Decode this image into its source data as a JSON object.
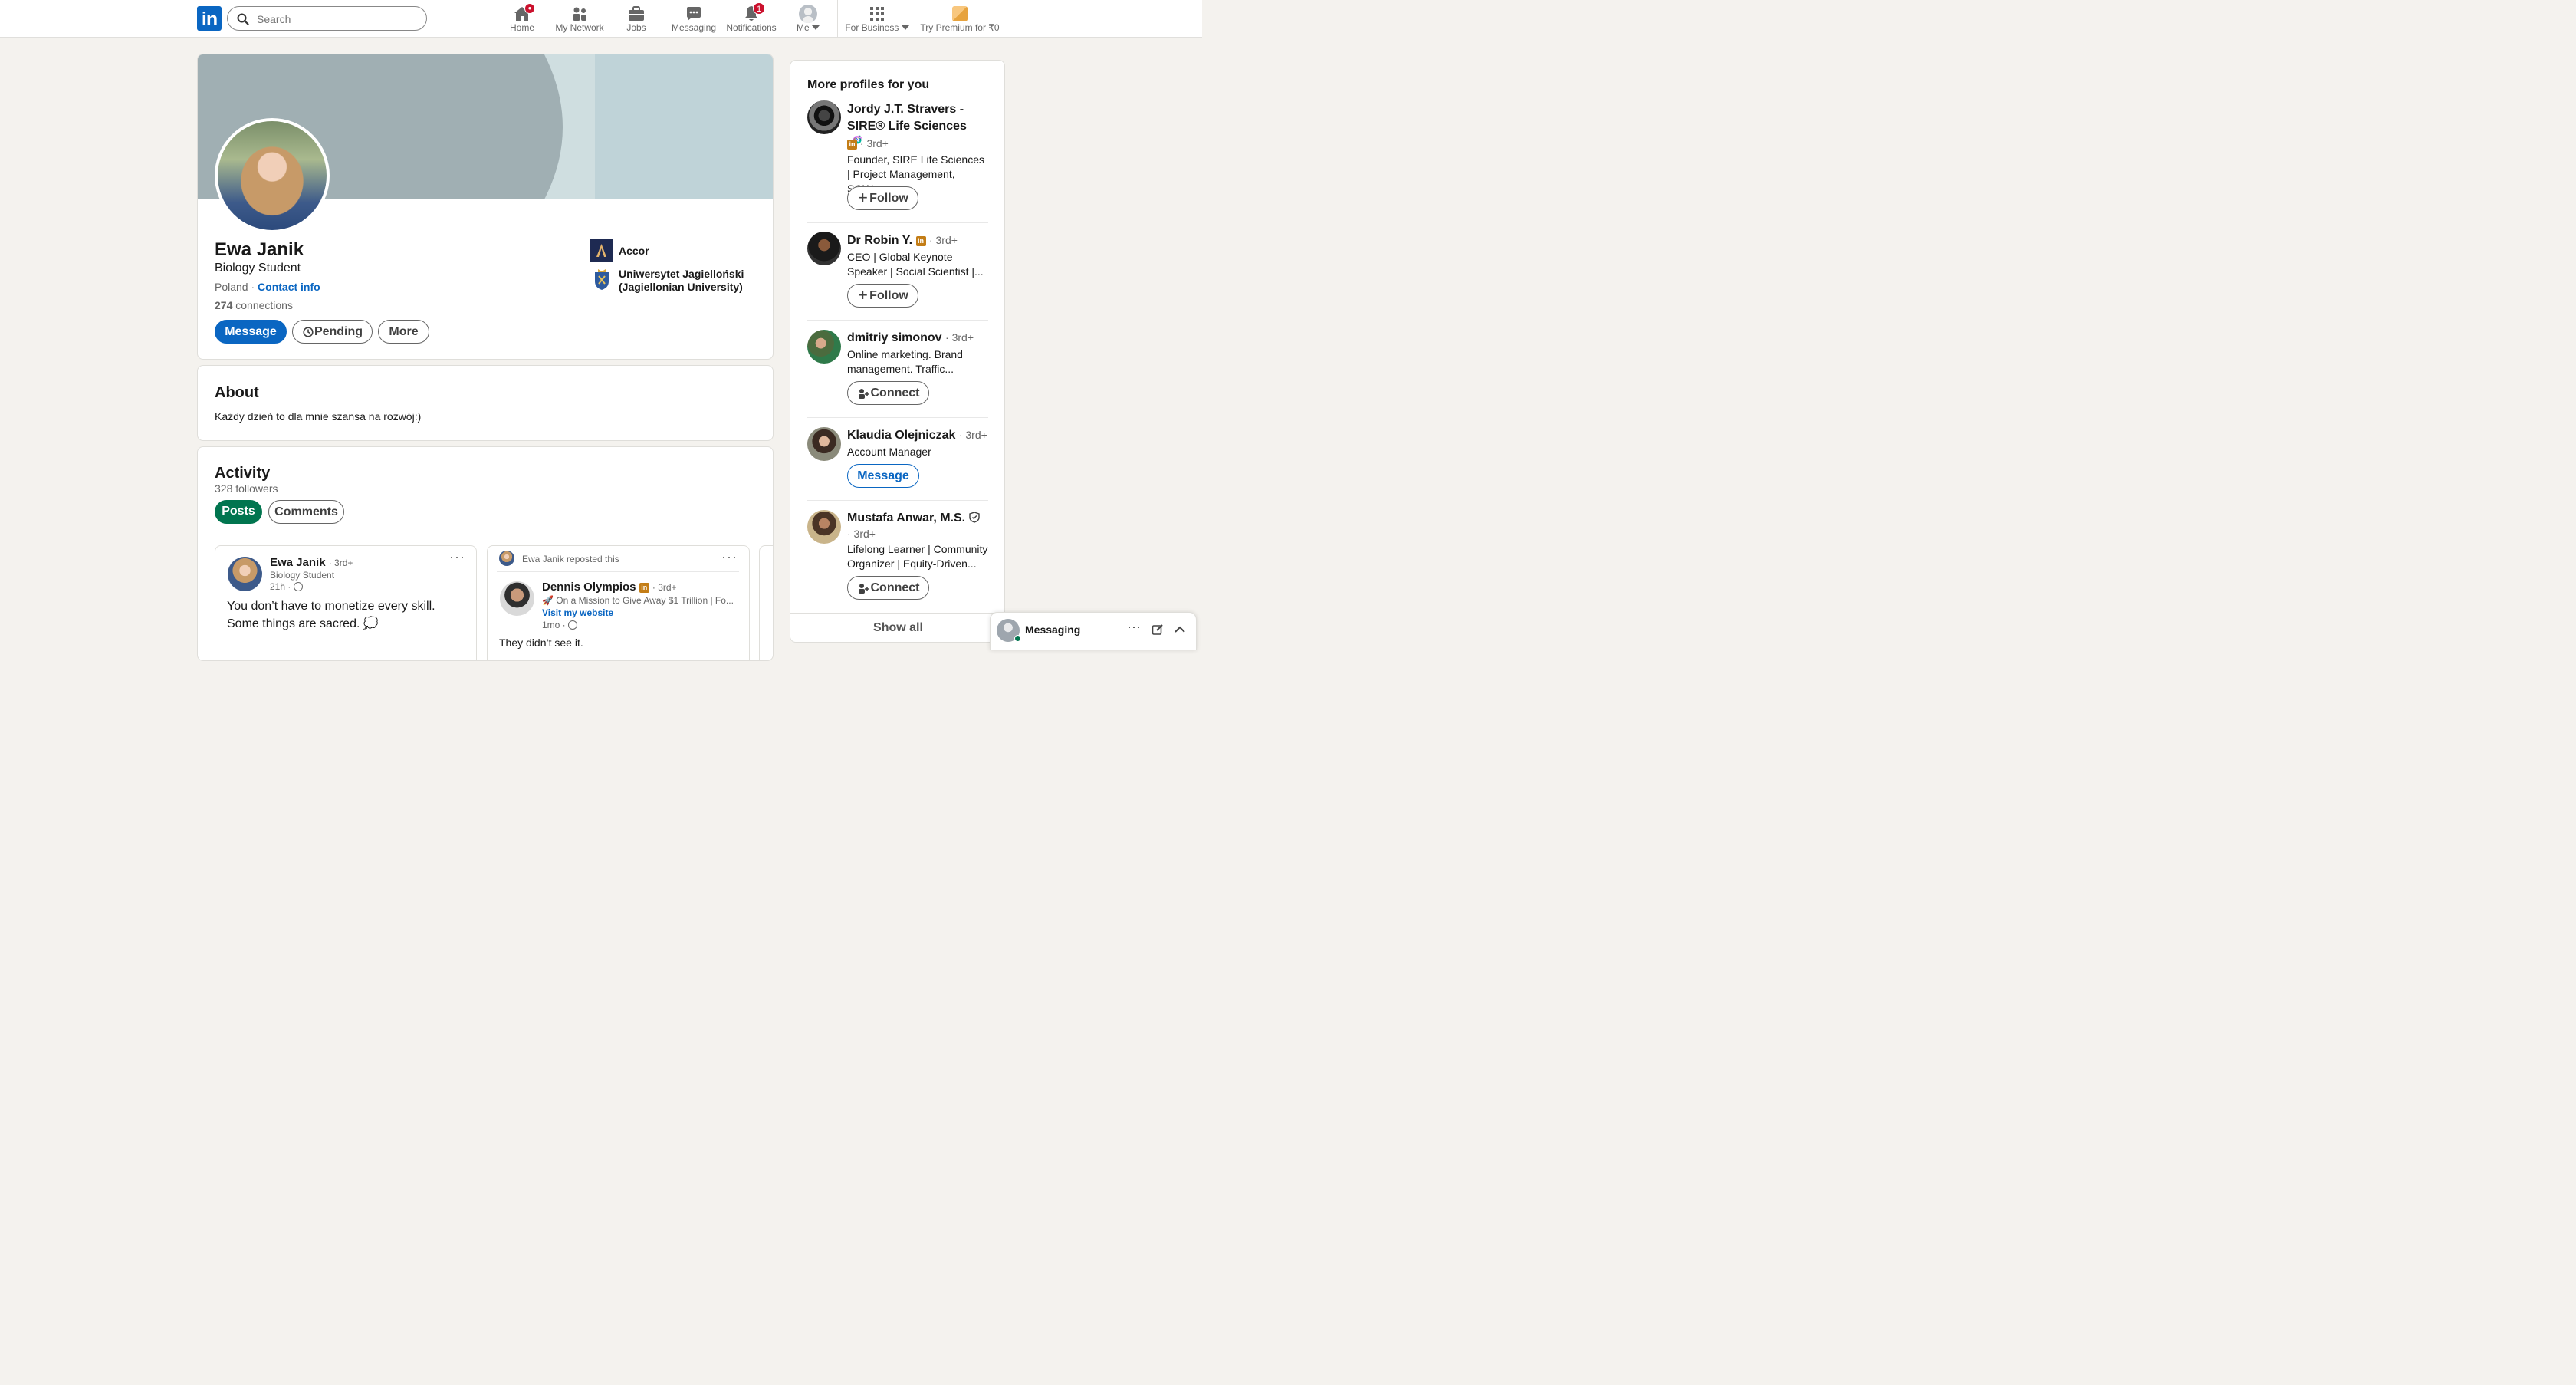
{
  "nav": {
    "search_placeholder": "Search",
    "items": [
      {
        "label": "Home",
        "icon": "home-icon"
      },
      {
        "label": "My Network",
        "icon": "network-icon"
      },
      {
        "label": "Jobs",
        "icon": "jobs-icon"
      },
      {
        "label": "Messaging",
        "icon": "messaging-icon"
      },
      {
        "label": "Notifications",
        "icon": "bell-icon",
        "badge": "1"
      },
      {
        "label": "Me",
        "icon": "avatar"
      },
      {
        "label": "For Business",
        "icon": "grid-icon"
      },
      {
        "label": "Try Premium for ₹0",
        "icon": "premium-icon"
      }
    ]
  },
  "profile": {
    "name": "Ewa Janik",
    "headline": "Biology Student",
    "location": "Poland",
    "contact_info": "Contact info",
    "connections_count": "274",
    "connections_label": "connections",
    "buttons": {
      "message": "Message",
      "pending": "Pending",
      "more": "More"
    },
    "experience": [
      {
        "name": "Accor"
      },
      {
        "name": "Uniwersytet Jagielloński (Jagiellonian University)"
      }
    ]
  },
  "about": {
    "title": "About",
    "text": "Każdy dzień to dla mnie szansa na rozwój:)"
  },
  "activity": {
    "title": "Activity",
    "followers": "328 followers",
    "tabs": [
      "Posts",
      "Comments"
    ],
    "posts": [
      {
        "author": "Ewa Janik",
        "degree": "· 3rd+",
        "headline": "Biology Student",
        "time": "21h ·",
        "text": "You don’t have to monetize every skill. Some things are sacred. 💭"
      },
      {
        "repost_label": "Ewa Janik reposted this",
        "author": "Dennis Olympios",
        "degree": "· 3rd+",
        "headline": "🚀 On a Mission to Give Away $1 Trillion | Fo...",
        "link": "Visit my website",
        "time": "1mo ·",
        "text": "They didn’t see it."
      }
    ]
  },
  "sidebar": {
    "title": "More profiles for you",
    "profiles": [
      {
        "name": "Jordy J.T. Stravers - SIRE® Life Sciences 🧬",
        "degree": "· 3rd+",
        "desc": "Founder, SIRE Life Sciences | Project Management, SOW,...",
        "action": "Follow"
      },
      {
        "name": "Dr Robin Y.",
        "degree": "· 3rd+",
        "desc": "CEO | Global Keynote Speaker | Social Scientist |...",
        "action": "Follow"
      },
      {
        "name": "dmitriy simonov",
        "degree": "· 3rd+",
        "desc": "Online marketing. Brand management. Traffic...",
        "action": "Connect"
      },
      {
        "name": "Klaudia Olejniczak",
        "degree": "· 3rd+",
        "desc": "Account Manager",
        "action": "Message"
      },
      {
        "name": "Mustafa Anwar, M.S.",
        "degree": "· 3rd+",
        "desc": "Lifelong Learner | Community Organizer | Equity-Driven...",
        "action": "Connect"
      }
    ],
    "show_all": "Show all"
  },
  "messaging_bar": {
    "label": "Messaging"
  }
}
